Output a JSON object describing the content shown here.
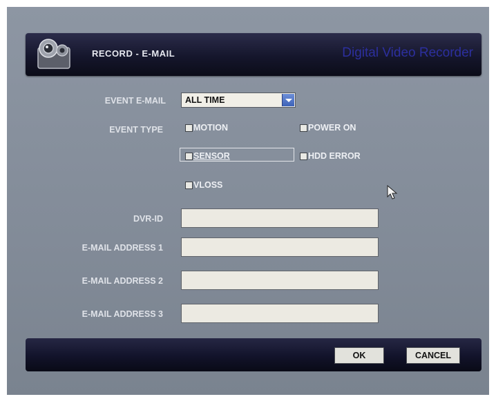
{
  "window": {
    "title": "RECORD - E-MAIL",
    "brand": "Digital Video Recorder",
    "icon": "camera-icon"
  },
  "form": {
    "event_email_label": "EVENT E-MAIL",
    "event_email_value": "ALL TIME",
    "event_type_label": "EVENT TYPE",
    "event_types": [
      {
        "label": "MOTION",
        "checked": false
      },
      {
        "label": "POWER ON",
        "checked": false
      },
      {
        "label": "SENSOR",
        "checked": false,
        "focused": true
      },
      {
        "label": "HDD ERROR",
        "checked": false
      },
      {
        "label": "VLOSS",
        "checked": false
      }
    ],
    "dvr_id_label": "DVR-ID",
    "dvr_id_value": "",
    "email_address_1_label": "E-MAIL ADDRESS 1",
    "email_address_1_value": "",
    "email_address_2_label": "E-MAIL ADDRESS 2",
    "email_address_2_value": "",
    "email_address_3_label": "E-MAIL ADDRESS 3",
    "email_address_3_value": ""
  },
  "buttons": {
    "ok": "OK",
    "cancel": "CANCEL"
  },
  "colors": {
    "panel_background": "#858e9a",
    "bar_background": "#15162c",
    "brand_text": "#2c2f9e",
    "dropdown_arrow": "#4a6fc5"
  }
}
